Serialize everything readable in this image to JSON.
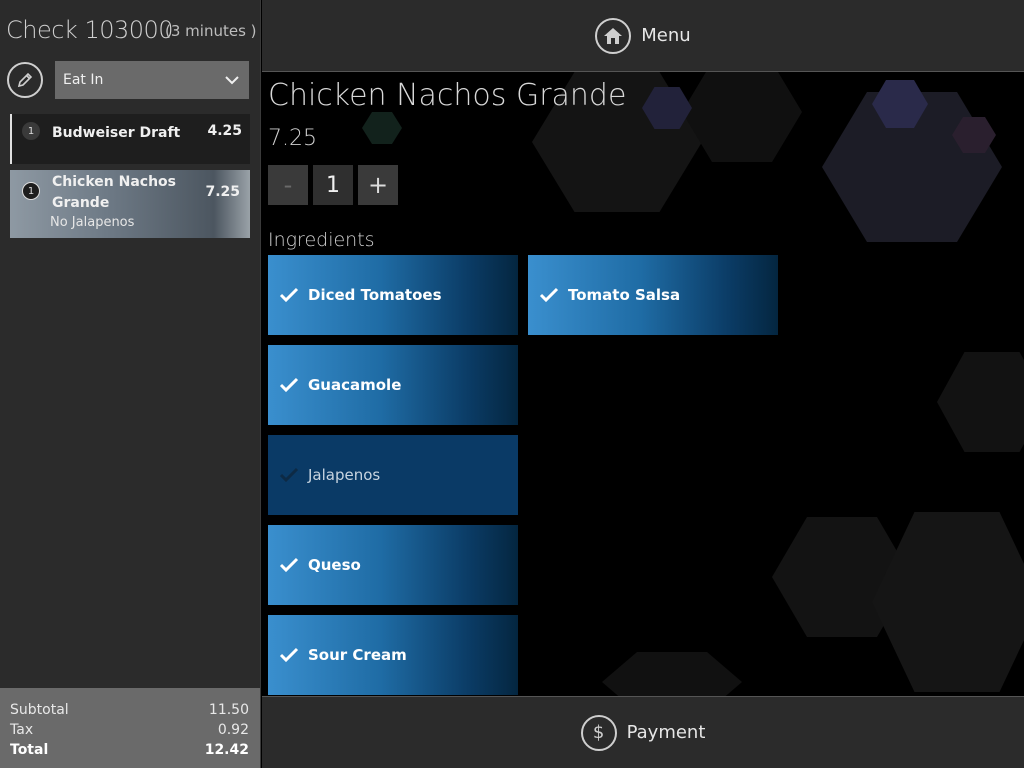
{
  "check": {
    "title": "Check 103000",
    "minutes": "(3 minutes )",
    "dining_option": "Eat In"
  },
  "order_items": [
    {
      "qty": "1",
      "name": "Budweiser Draft",
      "price": "4.25",
      "modifier": ""
    },
    {
      "qty": "1",
      "name": "Chicken Nachos Grande",
      "price": "7.25",
      "modifier": "No Jalapenos"
    }
  ],
  "totals": {
    "subtotal_label": "Subtotal",
    "subtotal": "11.50",
    "tax_label": "Tax",
    "tax": "0.92",
    "total_label": "Total",
    "total": "12.42"
  },
  "topbar": {
    "menu_label": "Menu"
  },
  "bottombar": {
    "payment_label": "Payment",
    "payment_icon_glyph": "$"
  },
  "product": {
    "name": "Chicken Nachos Grande",
    "price": "7.25",
    "quantity": "1",
    "minus_label": "-",
    "plus_label": "+"
  },
  "ingredients": {
    "heading": "Ingredients",
    "items": [
      {
        "label": "Diced Tomatoes",
        "checked": true
      },
      {
        "label": "Tomato Salsa",
        "checked": true
      },
      {
        "label": "Guacamole",
        "checked": true
      },
      {
        "label": "Jalapenos",
        "checked": false
      },
      {
        "label": "Queso",
        "checked": true
      },
      {
        "label": "Sour Cream",
        "checked": true
      }
    ]
  },
  "colors": {
    "panel": "#2b2b2b",
    "accent_blue": "#3a8fce",
    "tile_off": "#0a3a66",
    "totals_bg": "#6a6a6a"
  }
}
